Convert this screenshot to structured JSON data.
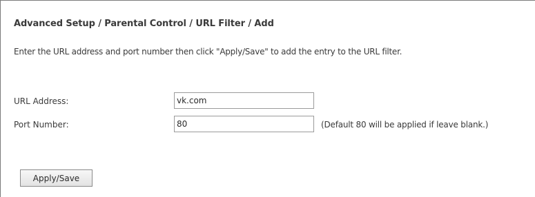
{
  "header": {
    "breadcrumb": "Advanced Setup / Parental Control / URL Filter / Add"
  },
  "main": {
    "instructions": "Enter the URL address and port number then click \"Apply/Save\" to add the entry to the URL filter.",
    "url_address": {
      "label": "URL Address:",
      "value": "vk.com"
    },
    "port_number": {
      "label": "Port Number:",
      "value": "80",
      "hint": "(Default 80 will be applied if leave blank.)"
    },
    "apply_save_label": "Apply/Save"
  }
}
